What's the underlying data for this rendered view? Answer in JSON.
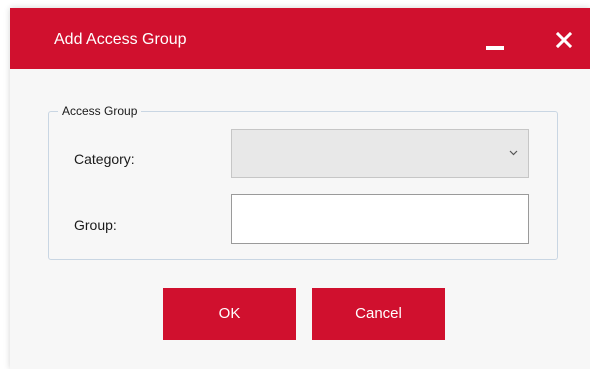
{
  "dialog": {
    "title": "Add Access Group",
    "accent_color": "#d0102e",
    "controls": {
      "minimize_icon": "minimize-icon",
      "close_icon": "close-icon"
    }
  },
  "access_group": {
    "legend": "Access Group",
    "category": {
      "label": "Category:",
      "selected_value": "",
      "icon": "chevron-down-icon"
    },
    "group": {
      "label": "Group:",
      "value": "",
      "placeholder": ""
    }
  },
  "actions": {
    "ok_label": "OK",
    "cancel_label": "Cancel"
  }
}
